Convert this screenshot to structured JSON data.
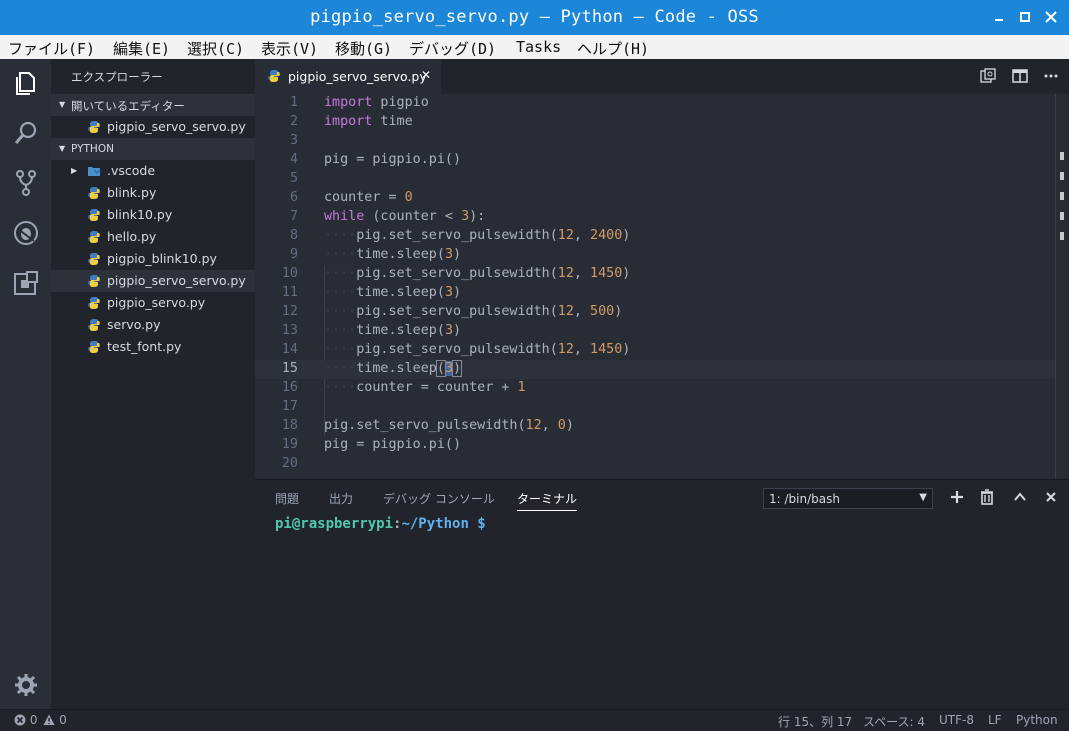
{
  "window": {
    "title": "pigpio_servo_servo.py — Python — Code - OSS"
  },
  "menu": [
    "ファイル(F)",
    "編集(E)",
    "選択(C)",
    "表示(V)",
    "移動(G)",
    "デバッグ(D)",
    "Tasks",
    "ヘルプ(H)"
  ],
  "activity_icons": [
    "explorer-icon",
    "search-icon",
    "source-control-icon",
    "debug-icon",
    "extensions-icon",
    "gear-icon"
  ],
  "sidebar": {
    "title": "エクスプローラー",
    "open_editors": {
      "header": "開いているエディター",
      "items": [
        "pigpio_servo_servo.py"
      ]
    },
    "folder": {
      "header": "PYTHON",
      "items": [
        ".vscode",
        "blink.py",
        "blink10.py",
        "hello.py",
        "pigpio_blink10.py",
        "pigpio_servo_servo.py",
        "pigpio_servo.py",
        "servo.py",
        "test_font.py"
      ],
      "selected": "pigpio_servo_servo.py"
    }
  },
  "editor": {
    "tab": {
      "label": "pigpio_servo_servo.py",
      "close": "✕"
    },
    "lines": [
      "import pigpio",
      "import time",
      "",
      "pig = pigpio.pi()",
      "",
      "counter = 0",
      "while (counter < 3):",
      "····pig.set_servo_pulsewidth(12, 2400)",
      "····time.sleep(3)",
      "····pig.set_servo_pulsewidth(12, 1450)",
      "····time.sleep(3)",
      "····pig.set_servo_pulsewidth(12, 500)",
      "····time.sleep(3)",
      "····pig.set_servo_pulsewidth(12, 1450)",
      "····time.sleep(3)",
      "····counter = counter + 1",
      "",
      "pig.set_servo_pulsewidth(12, 0)",
      "pig = pigpio.pi()",
      ""
    ],
    "current_line": 15
  },
  "panel": {
    "tabs": [
      "問題",
      "出力",
      "デバッグ コンソール",
      "ターミナル"
    ],
    "active_tab": "ターミナル",
    "terminal_select": "1: /bin/bash",
    "prompt_user": "pi@raspberrypi",
    "prompt_colon": ":",
    "prompt_path": "~/Python $"
  },
  "statusbar": {
    "errors": "0",
    "warnings": "0",
    "position": "行 15、列 17",
    "spaces": "スペース: 4",
    "encoding": "UTF-8",
    "eol": "LF",
    "language": "Python"
  },
  "colors": {
    "titlebar": "#1c87d8",
    "keyword": "#c678dd",
    "number": "#d19a66",
    "prompt_user": "#4ec9b0",
    "prompt_path": "#61afef"
  }
}
